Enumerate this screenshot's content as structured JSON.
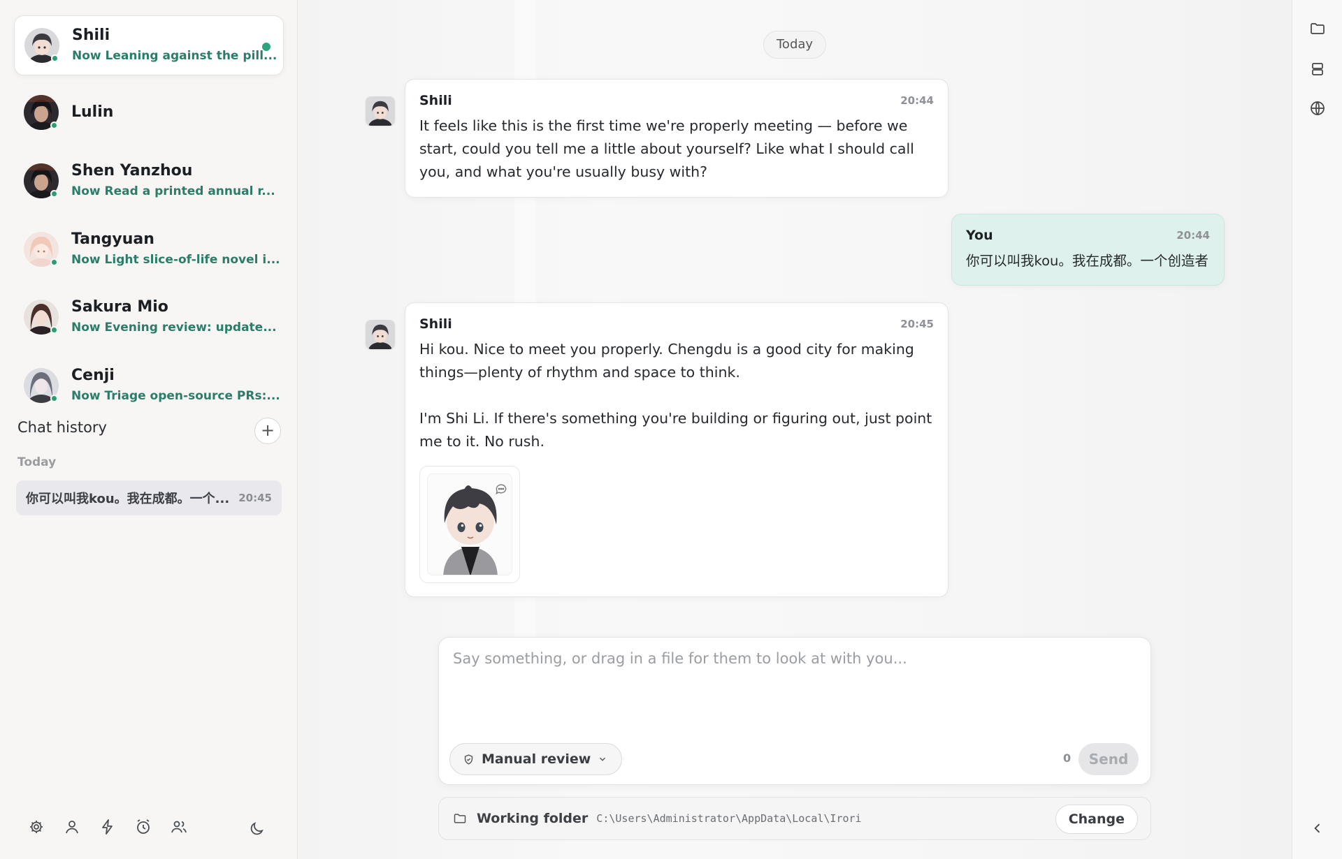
{
  "sidebar": {
    "contacts": [
      {
        "name": "Shili",
        "status": "Now Leaning against the pill...",
        "active": true
      },
      {
        "name": "Lulin",
        "status": ""
      },
      {
        "name": "Shen Yanzhou",
        "status": "Now Read a printed annual r..."
      },
      {
        "name": "Tangyuan",
        "status": "Now Light slice-of-life novel i..."
      },
      {
        "name": "Sakura Mio",
        "status": "Now Evening review: update..."
      },
      {
        "name": "Cenji",
        "status": "Now Triage open-source PRs:..."
      }
    ],
    "history_title": "Chat history",
    "history_add": "+",
    "history_group": "Today",
    "history_items": [
      {
        "title": "你可以叫我kou。我在成都。一个...",
        "time": "20:45"
      }
    ],
    "bottom_icons": [
      "settings-icon",
      "profile-icon",
      "lightning-icon",
      "alarm-clock-icon",
      "group-icon"
    ],
    "theme_icon": "moon-icon"
  },
  "chat": {
    "date_label": "Today",
    "messages": [
      {
        "sender": "Shili",
        "time": "20:44",
        "text": "It feels like this is the first time we're properly meeting — before we start, could you tell me a little about yourself? Like what I should call you, and what you're usually busy with?"
      },
      {
        "sender": "You",
        "time": "20:44",
        "text": "你可以叫我kou。我在成都。一个创造者"
      },
      {
        "sender": "Shili",
        "time": "20:45",
        "text": "Hi kou. Nice to meet you properly. Chengdu is a good city for making things—plenty of rhythm and space to think.\n\nI'm Shi Li. If there's something you're building or figuring out, just point me to it. No rush."
      }
    ]
  },
  "composer": {
    "placeholder": "Say something, or drag in a file for them to look at with you...",
    "value": "",
    "review_label": "Manual review",
    "char_count": "0",
    "send_label": "Send"
  },
  "folder": {
    "label": "Working folder",
    "path": "C:\\Users\\Administrator\\AppData\\Local\\Irori",
    "change_label": "Change"
  },
  "rail": {
    "icons": [
      "folder-icon",
      "storage-icon",
      "globe-icon",
      "chevron-left-icon"
    ]
  },
  "colors": {
    "accent": "#2a9d74",
    "status_text": "#2b7d6a",
    "user_bubble": "#dff1ec",
    "history_active": "#e9e8ec"
  }
}
